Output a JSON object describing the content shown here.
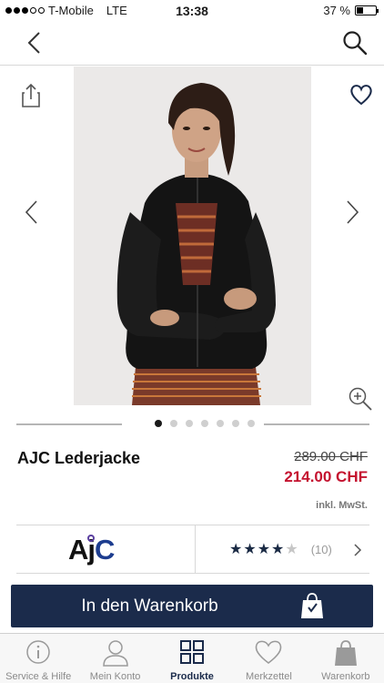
{
  "status_bar": {
    "carrier": "T-Mobile",
    "network": "LTE",
    "time": "13:38",
    "battery_text": "37 %",
    "battery_level": 0.37,
    "signal_bars_filled": 3,
    "signal_bars_total": 5
  },
  "nav": {
    "back_icon": "chevron-left-icon",
    "search_icon": "search-icon"
  },
  "gallery": {
    "share_icon": "share-icon",
    "wishlist_icon": "heart-icon",
    "prev_icon": "chevron-left-icon",
    "next_icon": "chevron-right-icon",
    "zoom_icon": "zoom-in-icon",
    "image_count": 7,
    "active_index": 0
  },
  "product": {
    "name": "AJC Lederjacke",
    "old_price": "289.00 CHF",
    "new_price": "214.00 CHF",
    "vat_note": "inkl. MwSt."
  },
  "brand": {
    "logo_text_a": "A",
    "logo_text_j": "j",
    "logo_text_c": "C",
    "rating": 4,
    "rating_max": 5,
    "review_count": "(10)"
  },
  "cart_button": {
    "label": "In den Warenkorb",
    "icon": "shopping-bag-icon"
  },
  "tabs": [
    {
      "label": "Service & Hilfe",
      "icon": "info-icon",
      "active": false
    },
    {
      "label": "Mein Konto",
      "icon": "user-icon",
      "active": false
    },
    {
      "label": "Produkte",
      "icon": "grid-icon",
      "active": true
    },
    {
      "label": "Merkzettel",
      "icon": "heart-icon",
      "active": false
    },
    {
      "label": "Warenkorb",
      "icon": "shopping-bag-icon",
      "active": false
    }
  ],
  "colors": {
    "accent_navy": "#1b2b4b",
    "sale_red": "#c4122f"
  }
}
